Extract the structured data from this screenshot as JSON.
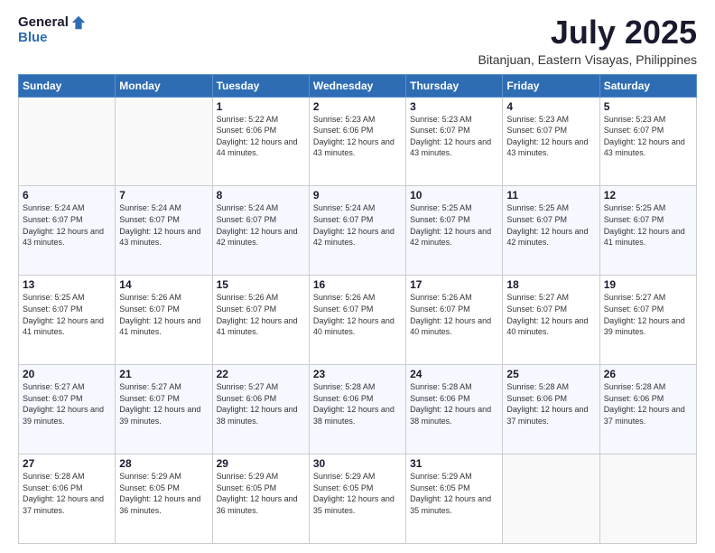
{
  "logo": {
    "general": "General",
    "blue": "Blue"
  },
  "title": "July 2025",
  "subtitle": "Bitanjuan, Eastern Visayas, Philippines",
  "headers": [
    "Sunday",
    "Monday",
    "Tuesday",
    "Wednesday",
    "Thursday",
    "Friday",
    "Saturday"
  ],
  "weeks": [
    [
      {
        "day": "",
        "sunrise": "",
        "sunset": "",
        "daylight": ""
      },
      {
        "day": "",
        "sunrise": "",
        "sunset": "",
        "daylight": ""
      },
      {
        "day": "1",
        "sunrise": "Sunrise: 5:22 AM",
        "sunset": "Sunset: 6:06 PM",
        "daylight": "Daylight: 12 hours and 44 minutes."
      },
      {
        "day": "2",
        "sunrise": "Sunrise: 5:23 AM",
        "sunset": "Sunset: 6:06 PM",
        "daylight": "Daylight: 12 hours and 43 minutes."
      },
      {
        "day": "3",
        "sunrise": "Sunrise: 5:23 AM",
        "sunset": "Sunset: 6:07 PM",
        "daylight": "Daylight: 12 hours and 43 minutes."
      },
      {
        "day": "4",
        "sunrise": "Sunrise: 5:23 AM",
        "sunset": "Sunset: 6:07 PM",
        "daylight": "Daylight: 12 hours and 43 minutes."
      },
      {
        "day": "5",
        "sunrise": "Sunrise: 5:23 AM",
        "sunset": "Sunset: 6:07 PM",
        "daylight": "Daylight: 12 hours and 43 minutes."
      }
    ],
    [
      {
        "day": "6",
        "sunrise": "Sunrise: 5:24 AM",
        "sunset": "Sunset: 6:07 PM",
        "daylight": "Daylight: 12 hours and 43 minutes."
      },
      {
        "day": "7",
        "sunrise": "Sunrise: 5:24 AM",
        "sunset": "Sunset: 6:07 PM",
        "daylight": "Daylight: 12 hours and 43 minutes."
      },
      {
        "day": "8",
        "sunrise": "Sunrise: 5:24 AM",
        "sunset": "Sunset: 6:07 PM",
        "daylight": "Daylight: 12 hours and 42 minutes."
      },
      {
        "day": "9",
        "sunrise": "Sunrise: 5:24 AM",
        "sunset": "Sunset: 6:07 PM",
        "daylight": "Daylight: 12 hours and 42 minutes."
      },
      {
        "day": "10",
        "sunrise": "Sunrise: 5:25 AM",
        "sunset": "Sunset: 6:07 PM",
        "daylight": "Daylight: 12 hours and 42 minutes."
      },
      {
        "day": "11",
        "sunrise": "Sunrise: 5:25 AM",
        "sunset": "Sunset: 6:07 PM",
        "daylight": "Daylight: 12 hours and 42 minutes."
      },
      {
        "day": "12",
        "sunrise": "Sunrise: 5:25 AM",
        "sunset": "Sunset: 6:07 PM",
        "daylight": "Daylight: 12 hours and 41 minutes."
      }
    ],
    [
      {
        "day": "13",
        "sunrise": "Sunrise: 5:25 AM",
        "sunset": "Sunset: 6:07 PM",
        "daylight": "Daylight: 12 hours and 41 minutes."
      },
      {
        "day": "14",
        "sunrise": "Sunrise: 5:26 AM",
        "sunset": "Sunset: 6:07 PM",
        "daylight": "Daylight: 12 hours and 41 minutes."
      },
      {
        "day": "15",
        "sunrise": "Sunrise: 5:26 AM",
        "sunset": "Sunset: 6:07 PM",
        "daylight": "Daylight: 12 hours and 41 minutes."
      },
      {
        "day": "16",
        "sunrise": "Sunrise: 5:26 AM",
        "sunset": "Sunset: 6:07 PM",
        "daylight": "Daylight: 12 hours and 40 minutes."
      },
      {
        "day": "17",
        "sunrise": "Sunrise: 5:26 AM",
        "sunset": "Sunset: 6:07 PM",
        "daylight": "Daylight: 12 hours and 40 minutes."
      },
      {
        "day": "18",
        "sunrise": "Sunrise: 5:27 AM",
        "sunset": "Sunset: 6:07 PM",
        "daylight": "Daylight: 12 hours and 40 minutes."
      },
      {
        "day": "19",
        "sunrise": "Sunrise: 5:27 AM",
        "sunset": "Sunset: 6:07 PM",
        "daylight": "Daylight: 12 hours and 39 minutes."
      }
    ],
    [
      {
        "day": "20",
        "sunrise": "Sunrise: 5:27 AM",
        "sunset": "Sunset: 6:07 PM",
        "daylight": "Daylight: 12 hours and 39 minutes."
      },
      {
        "day": "21",
        "sunrise": "Sunrise: 5:27 AM",
        "sunset": "Sunset: 6:07 PM",
        "daylight": "Daylight: 12 hours and 39 minutes."
      },
      {
        "day": "22",
        "sunrise": "Sunrise: 5:27 AM",
        "sunset": "Sunset: 6:06 PM",
        "daylight": "Daylight: 12 hours and 38 minutes."
      },
      {
        "day": "23",
        "sunrise": "Sunrise: 5:28 AM",
        "sunset": "Sunset: 6:06 PM",
        "daylight": "Daylight: 12 hours and 38 minutes."
      },
      {
        "day": "24",
        "sunrise": "Sunrise: 5:28 AM",
        "sunset": "Sunset: 6:06 PM",
        "daylight": "Daylight: 12 hours and 38 minutes."
      },
      {
        "day": "25",
        "sunrise": "Sunrise: 5:28 AM",
        "sunset": "Sunset: 6:06 PM",
        "daylight": "Daylight: 12 hours and 37 minutes."
      },
      {
        "day": "26",
        "sunrise": "Sunrise: 5:28 AM",
        "sunset": "Sunset: 6:06 PM",
        "daylight": "Daylight: 12 hours and 37 minutes."
      }
    ],
    [
      {
        "day": "27",
        "sunrise": "Sunrise: 5:28 AM",
        "sunset": "Sunset: 6:06 PM",
        "daylight": "Daylight: 12 hours and 37 minutes."
      },
      {
        "day": "28",
        "sunrise": "Sunrise: 5:29 AM",
        "sunset": "Sunset: 6:05 PM",
        "daylight": "Daylight: 12 hours and 36 minutes."
      },
      {
        "day": "29",
        "sunrise": "Sunrise: 5:29 AM",
        "sunset": "Sunset: 6:05 PM",
        "daylight": "Daylight: 12 hours and 36 minutes."
      },
      {
        "day": "30",
        "sunrise": "Sunrise: 5:29 AM",
        "sunset": "Sunset: 6:05 PM",
        "daylight": "Daylight: 12 hours and 35 minutes."
      },
      {
        "day": "31",
        "sunrise": "Sunrise: 5:29 AM",
        "sunset": "Sunset: 6:05 PM",
        "daylight": "Daylight: 12 hours and 35 minutes."
      },
      {
        "day": "",
        "sunrise": "",
        "sunset": "",
        "daylight": ""
      },
      {
        "day": "",
        "sunrise": "",
        "sunset": "",
        "daylight": ""
      }
    ]
  ]
}
